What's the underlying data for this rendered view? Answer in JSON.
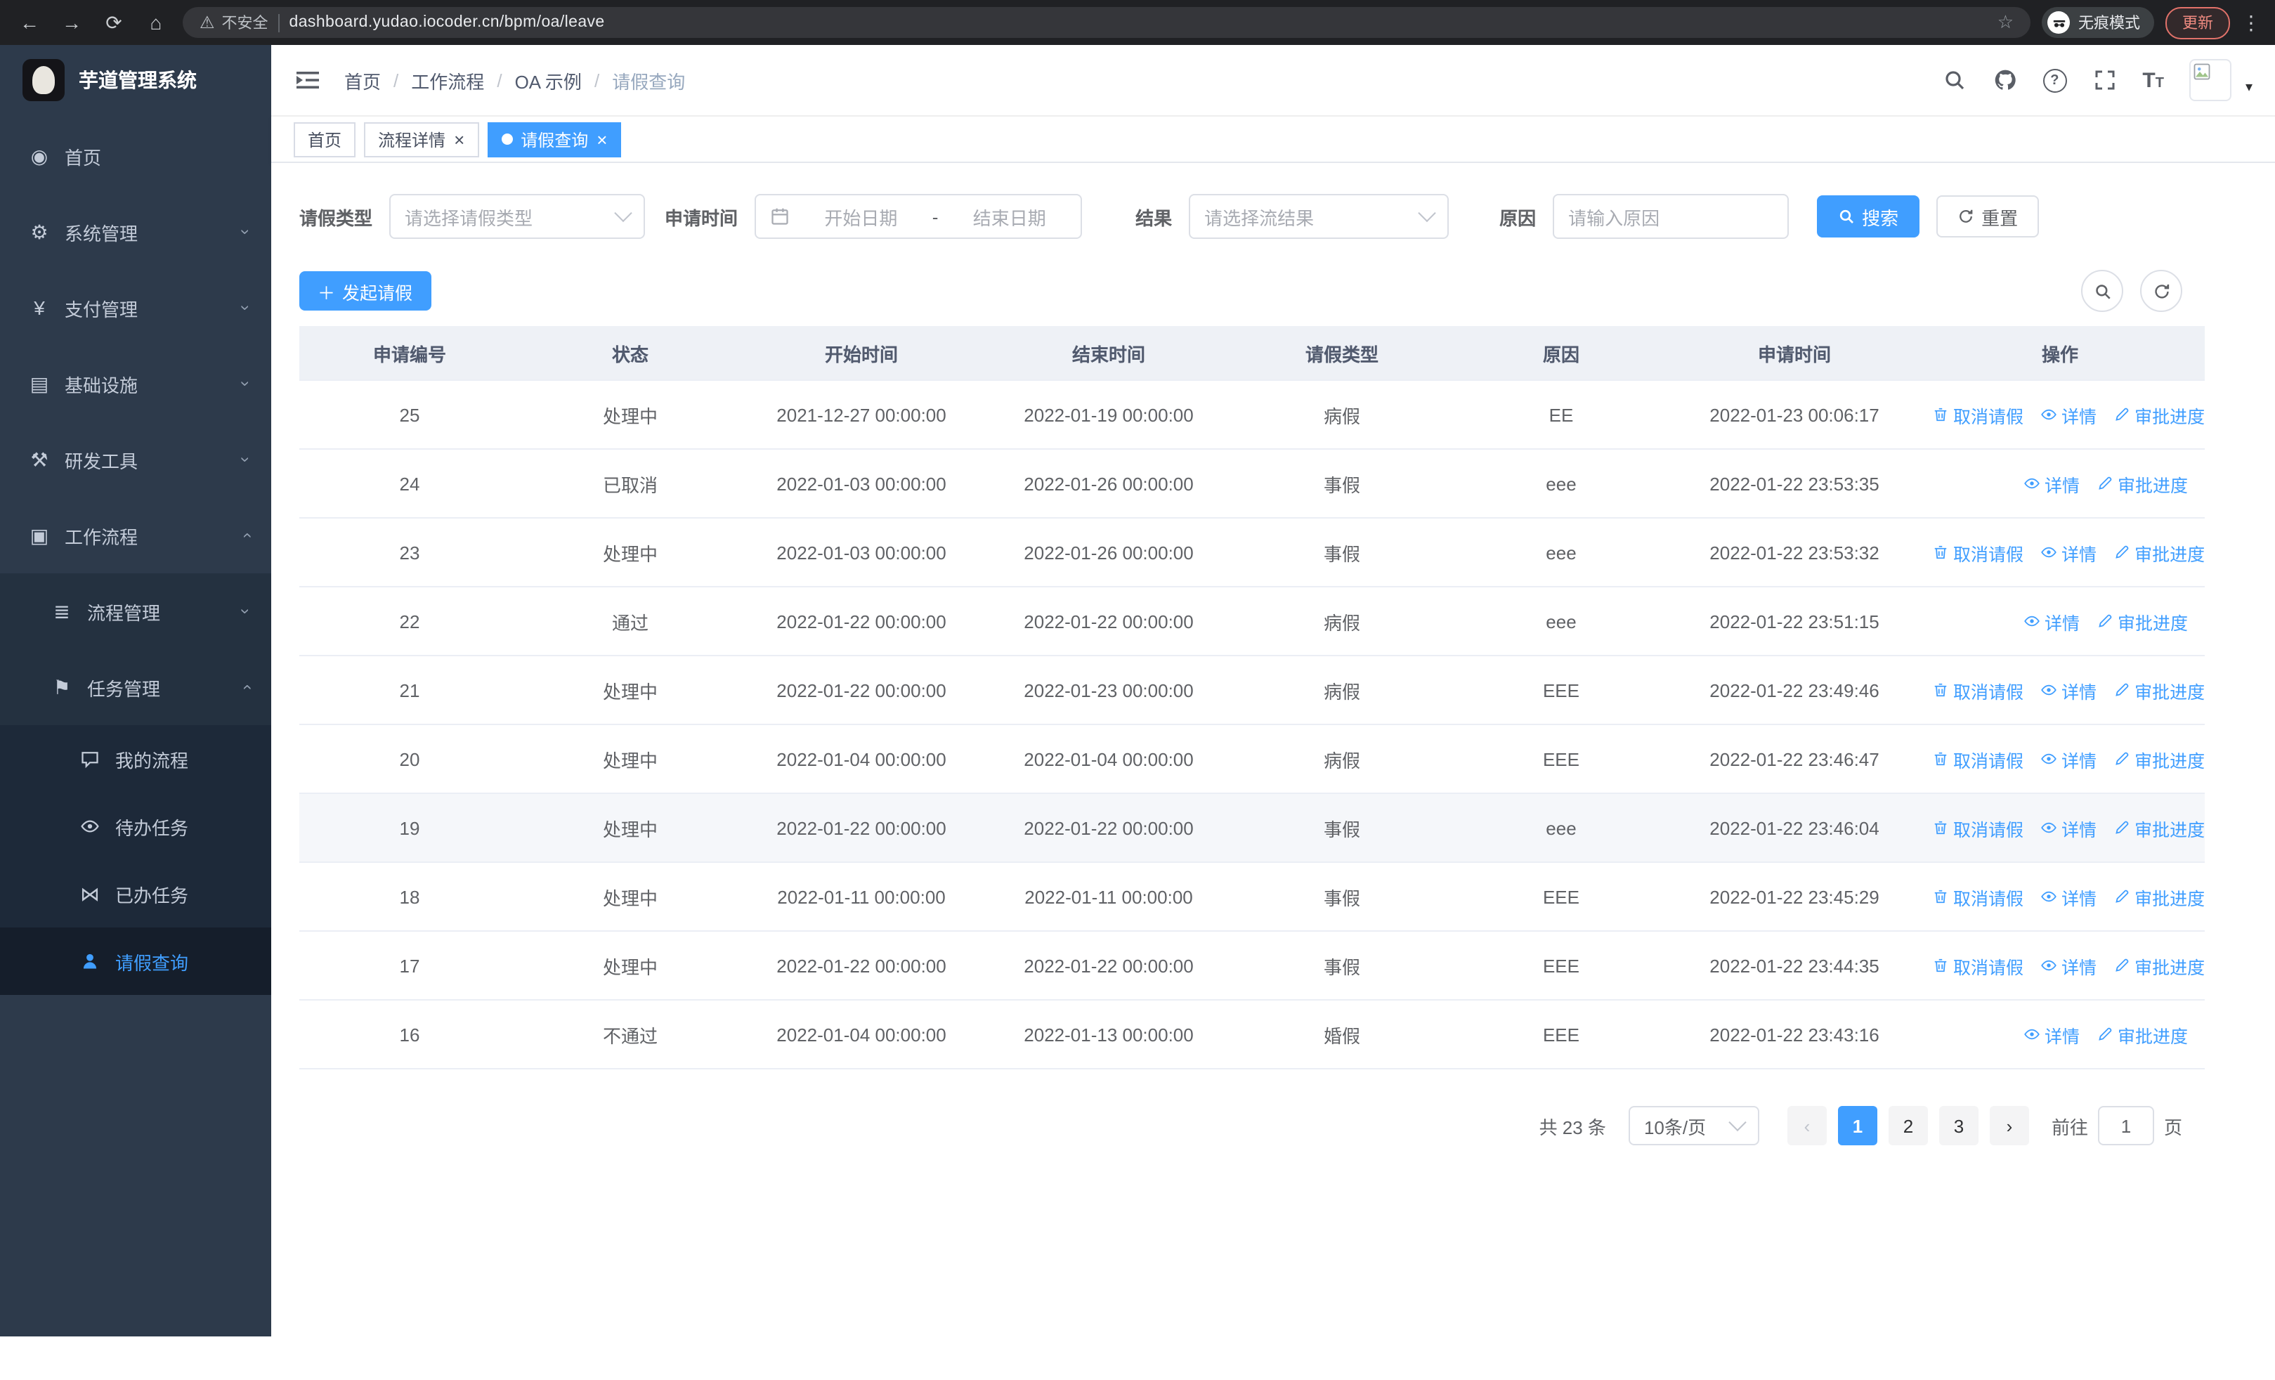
{
  "colors": {
    "primary": "#409eff",
    "sidebar_bg": "#2d3a4b"
  },
  "browser": {
    "security_label": "不安全",
    "url": "dashboard.yudao.iocoder.cn/bpm/oa/leave",
    "incognito_label": "无痕模式",
    "update_label": "更新"
  },
  "sidebar": {
    "logo_title": "芋道管理系统",
    "items": [
      {
        "label": "首页",
        "icon": "dashboard-icon",
        "level": 1
      },
      {
        "label": "系统管理",
        "icon": "gear-icon",
        "level": 1,
        "arrow": "down"
      },
      {
        "label": "支付管理",
        "icon": "yen-icon",
        "level": 1,
        "arrow": "down"
      },
      {
        "label": "基础设施",
        "icon": "infra-icon",
        "level": 1,
        "arrow": "down"
      },
      {
        "label": "研发工具",
        "icon": "tools-icon",
        "level": 1,
        "arrow": "down"
      },
      {
        "label": "工作流程",
        "icon": "workflow-icon",
        "level": 1,
        "arrow": "up"
      },
      {
        "label": "流程管理",
        "icon": "process-icon",
        "level": 2,
        "arrow": "down"
      },
      {
        "label": "任务管理",
        "icon": "task-icon",
        "level": 2,
        "arrow": "up"
      },
      {
        "label": "我的流程",
        "icon": "chat-icon",
        "level": 3
      },
      {
        "label": "待办任务",
        "icon": "eye-icon",
        "level": 3
      },
      {
        "label": "已办任务",
        "icon": "done-icon",
        "level": 3
      },
      {
        "label": "请假查询",
        "icon": "person-icon",
        "level": 3,
        "active": true
      }
    ]
  },
  "header": {
    "breadcrumb": [
      "首页",
      "工作流程",
      "OA 示例",
      "请假查询"
    ]
  },
  "tags": [
    {
      "label": "首页",
      "closable": false,
      "active": false
    },
    {
      "label": "流程详情",
      "closable": true,
      "active": false
    },
    {
      "label": "请假查询",
      "closable": true,
      "active": true
    }
  ],
  "filters": {
    "type_label": "请假类型",
    "type_placeholder": "请选择请假类型",
    "time_label": "申请时间",
    "start_placeholder": "开始日期",
    "separator": "-",
    "end_placeholder": "结束日期",
    "result_label": "结果",
    "result_placeholder": "请选择流结果",
    "reason_label": "原因",
    "reason_placeholder": "请输入原因",
    "search_label": "搜索",
    "reset_label": "重置"
  },
  "toolbar": {
    "create_label": "发起请假"
  },
  "table": {
    "columns": [
      "申请编号",
      "状态",
      "开始时间",
      "结束时间",
      "请假类型",
      "原因",
      "申请时间",
      "操作"
    ],
    "action_labels": {
      "cancel": "取消请假",
      "detail": "详情",
      "progress": "审批进度"
    },
    "rows": [
      {
        "id": "25",
        "status": "处理中",
        "start": "2021-12-27 00:00:00",
        "end": "2022-01-19 00:00:00",
        "type": "病假",
        "reason": "EE",
        "applied": "2022-01-23 00:06:17",
        "actions": [
          "cancel",
          "detail",
          "progress"
        ]
      },
      {
        "id": "24",
        "status": "已取消",
        "start": "2022-01-03 00:00:00",
        "end": "2022-01-26 00:00:00",
        "type": "事假",
        "reason": "eee",
        "applied": "2022-01-22 23:53:35",
        "actions": [
          "detail",
          "progress"
        ]
      },
      {
        "id": "23",
        "status": "处理中",
        "start": "2022-01-03 00:00:00",
        "end": "2022-01-26 00:00:00",
        "type": "事假",
        "reason": "eee",
        "applied": "2022-01-22 23:53:32",
        "actions": [
          "cancel",
          "detail",
          "progress"
        ]
      },
      {
        "id": "22",
        "status": "通过",
        "start": "2022-01-22 00:00:00",
        "end": "2022-01-22 00:00:00",
        "type": "病假",
        "reason": "eee",
        "applied": "2022-01-22 23:51:15",
        "actions": [
          "detail",
          "progress"
        ]
      },
      {
        "id": "21",
        "status": "处理中",
        "start": "2022-01-22 00:00:00",
        "end": "2022-01-23 00:00:00",
        "type": "病假",
        "reason": "EEE",
        "applied": "2022-01-22 23:49:46",
        "actions": [
          "cancel",
          "detail",
          "progress"
        ]
      },
      {
        "id": "20",
        "status": "处理中",
        "start": "2022-01-04 00:00:00",
        "end": "2022-01-04 00:00:00",
        "type": "病假",
        "reason": "EEE",
        "applied": "2022-01-22 23:46:47",
        "actions": [
          "cancel",
          "detail",
          "progress"
        ]
      },
      {
        "id": "19",
        "status": "处理中",
        "start": "2022-01-22 00:00:00",
        "end": "2022-01-22 00:00:00",
        "type": "事假",
        "reason": "eee",
        "applied": "2022-01-22 23:46:04",
        "actions": [
          "cancel",
          "detail",
          "progress"
        ],
        "highlighted": true
      },
      {
        "id": "18",
        "status": "处理中",
        "start": "2022-01-11 00:00:00",
        "end": "2022-01-11 00:00:00",
        "type": "事假",
        "reason": "EEE",
        "applied": "2022-01-22 23:45:29",
        "actions": [
          "cancel",
          "detail",
          "progress"
        ]
      },
      {
        "id": "17",
        "status": "处理中",
        "start": "2022-01-22 00:00:00",
        "end": "2022-01-22 00:00:00",
        "type": "事假",
        "reason": "EEE",
        "applied": "2022-01-22 23:44:35",
        "actions": [
          "cancel",
          "detail",
          "progress"
        ]
      },
      {
        "id": "16",
        "status": "不通过",
        "start": "2022-01-04 00:00:00",
        "end": "2022-01-13 00:00:00",
        "type": "婚假",
        "reason": "EEE",
        "applied": "2022-01-22 23:43:16",
        "actions": [
          "detail",
          "progress"
        ]
      }
    ]
  },
  "pagination": {
    "total_label": "共 23 条",
    "page_size": "10条/页",
    "pages": [
      "1",
      "2",
      "3"
    ],
    "active_page": "1",
    "goto_label": "前往",
    "goto_value": "1",
    "page_label": "页"
  }
}
